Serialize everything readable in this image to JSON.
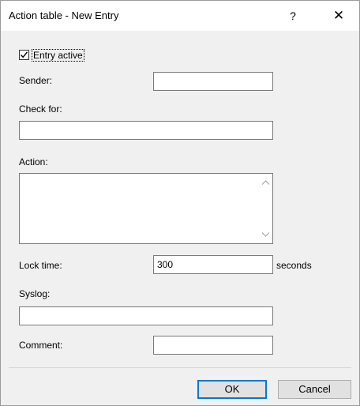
{
  "window": {
    "title": "Action table - New Entry",
    "help_glyph": "?",
    "close_glyph": "✕"
  },
  "form": {
    "entry_active": {
      "label": "Entry active",
      "checked": true
    },
    "sender": {
      "label": "Sender:",
      "value": ""
    },
    "check_for": {
      "label": "Check for:",
      "value": ""
    },
    "action": {
      "label": "Action:",
      "value": ""
    },
    "lock_time": {
      "label": "Lock time:",
      "value": "300",
      "unit": "seconds"
    },
    "syslog": {
      "label": "Syslog:",
      "value": ""
    },
    "comment": {
      "label": "Comment:",
      "value": ""
    }
  },
  "buttons": {
    "ok": "OK",
    "cancel": "Cancel"
  },
  "colors": {
    "accent": "#0078d7",
    "dialog_bg": "#f0f0f0",
    "field_border": "#7a7a7a"
  }
}
